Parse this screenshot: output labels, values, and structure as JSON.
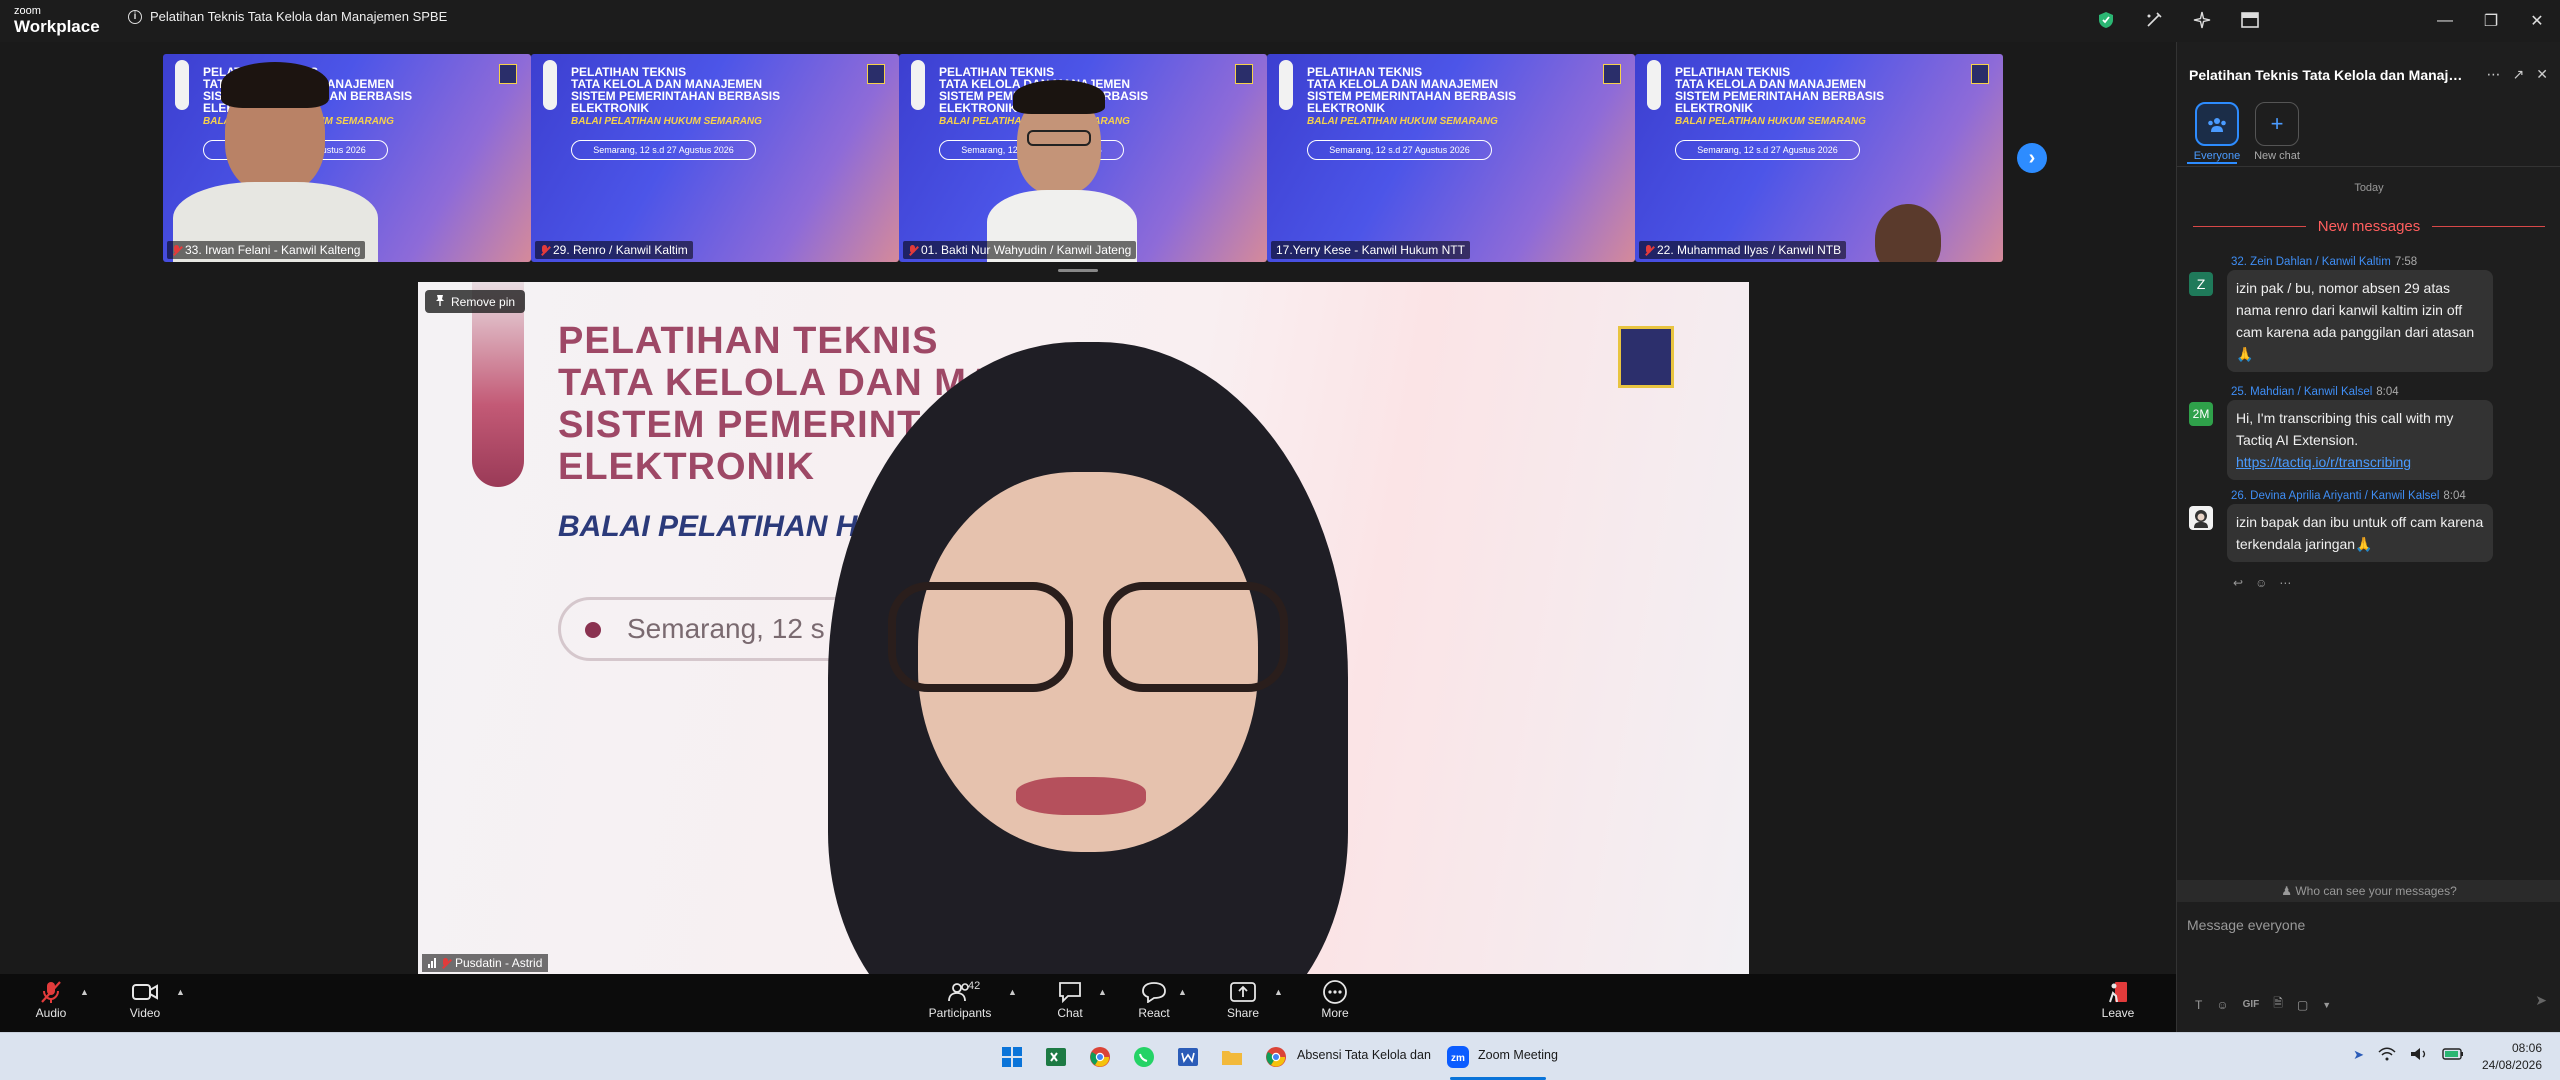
{
  "app": {
    "logo_line1": "zoom",
    "logo_line2": "Workplace",
    "meeting_title": "Pelatihan Teknis Tata Kelola dan Manajemen SPBE"
  },
  "slide": {
    "title_lines": [
      "PELATIHAN TEKNIS",
      "TATA KELOLA DAN MANAJEMEN",
      "SISTEM PEMERINTAHAN BERBASIS",
      "ELEKTRONIK"
    ],
    "subtitle": "BALAI PELATIHAN HUKUM SEMARANG",
    "date_pill": "Semarang, 12 s.d 27 Agustus 2026"
  },
  "gallery": {
    "tiles": [
      {
        "name": "33. Irwan Felani - Kanwil Kalteng",
        "muted": true
      },
      {
        "name": "29. Renro / Kanwil Kaltim",
        "muted": true
      },
      {
        "name": "01. Bakti Nur Wahyudin / Kanwil Jateng",
        "muted": true
      },
      {
        "name": "17.Yerry Kese - Kanwil Hukum NTT",
        "muted": false
      },
      {
        "name": "22. Muhammad Ilyas / Kanwil NTB",
        "muted": true
      }
    ]
  },
  "main_video": {
    "remove_pin_label": "Remove pin",
    "participant_name": "Pusdatin - Astrid",
    "slide_title_lines": [
      "PELATIHAN TEKNIS",
      "TATA KELOLA DAN MANAJEMEN",
      "SISTEM PEMERINTAHAN BERBASIS",
      "ELEKTRONIK"
    ],
    "slide_subtitle": "BALAI PELATIHAN HUKUM SEMARANG",
    "slide_pill": "Semarang, 12 s"
  },
  "toolbar": {
    "audio": "Audio",
    "video": "Video",
    "participants": "Participants",
    "participant_count": "42",
    "chat": "Chat",
    "react": "React",
    "share": "Share",
    "more": "More",
    "leave": "Leave"
  },
  "chat_panel": {
    "title": "Pelatihan Teknis Tata Kelola dan Manajem...",
    "channels": [
      {
        "label": "Everyone",
        "active": true
      },
      {
        "label": "New chat",
        "active": false
      }
    ],
    "today_label": "Today",
    "new_messages_label": "New messages",
    "messages": [
      {
        "sender": "32. Zein Dahlan / Kanwil Kaltim",
        "time": "7:58",
        "avatar": "Z",
        "avatar_color": "#1f7a5a",
        "text": "izin pak / bu, nomor absen 29 atas nama renro dari kanwil kaltim izin off cam karena ada panggilan dari atasan 🙏",
        "link": ""
      },
      {
        "sender": "25. Mahdian / Kanwil Kalsel",
        "time": "8:04",
        "avatar": "2M",
        "avatar_color": "#2fa14a",
        "text": "Hi, I'm transcribing this call with my Tactiq AI Extension.",
        "link": "https://tactiq.io/r/transcribing"
      },
      {
        "sender": "26. Devina Aprilia Ariyanti / Kanwil Kalsel",
        "time": "8:04",
        "avatar": "",
        "avatar_color": "#f2f2f2",
        "text": "izin bapak dan ibu untuk off cam karena terkendala jaringan🙏",
        "link": ""
      }
    ],
    "who_can_see": "Who can see your messages?",
    "input_placeholder": "Message everyone",
    "gif_label": "GIF"
  },
  "taskbar": {
    "chrome_window_label": "Absensi Tata Kelola dan",
    "zoom_window_label": "Zoom Meeting",
    "time": "08:06",
    "date": "24/08/2026"
  },
  "colors": {
    "accent": "#2d8cff",
    "muted_red": "#e23b3b",
    "new_messages_red": "#ff5e5e",
    "slide_blue": "#4c55e8"
  }
}
